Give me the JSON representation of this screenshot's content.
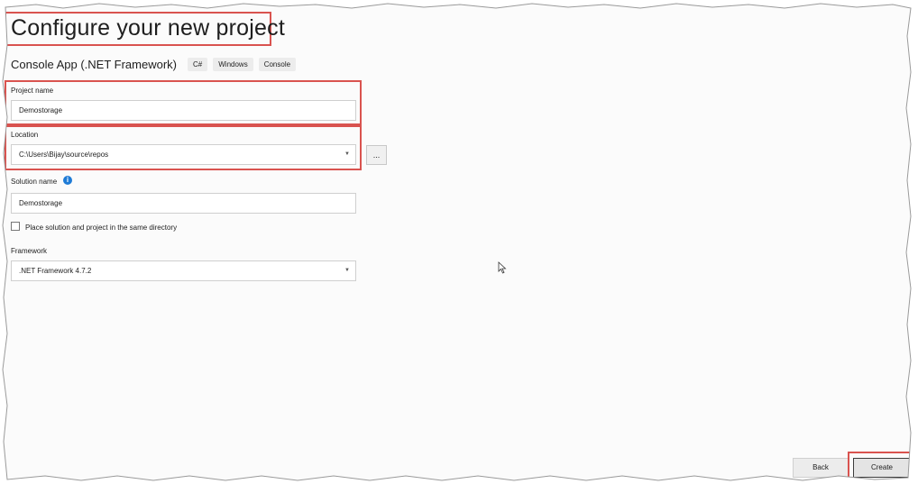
{
  "page": {
    "title": "Configure your new project",
    "subtitle": "Console App (.NET Framework)",
    "tags": [
      "C#",
      "Windows",
      "Console"
    ]
  },
  "form": {
    "project_name": {
      "label": "Project name",
      "value": "Demostorage"
    },
    "location": {
      "label": "Location",
      "value": "C:\\Users\\Bijay\\source\\repos",
      "browse_label": "..."
    },
    "solution_name": {
      "label": "Solution name",
      "value": "Demostorage",
      "info_icon": "info-icon"
    },
    "same_directory": {
      "label": "Place solution and project in the same directory",
      "checked": false
    },
    "framework": {
      "label": "Framework",
      "value": ".NET Framework 4.7.2"
    }
  },
  "footer": {
    "back_label": "Back",
    "create_label": "Create"
  },
  "colors": {
    "highlight": "#d9534f",
    "info": "#1e7bd6",
    "background": "#fbfbfb"
  }
}
